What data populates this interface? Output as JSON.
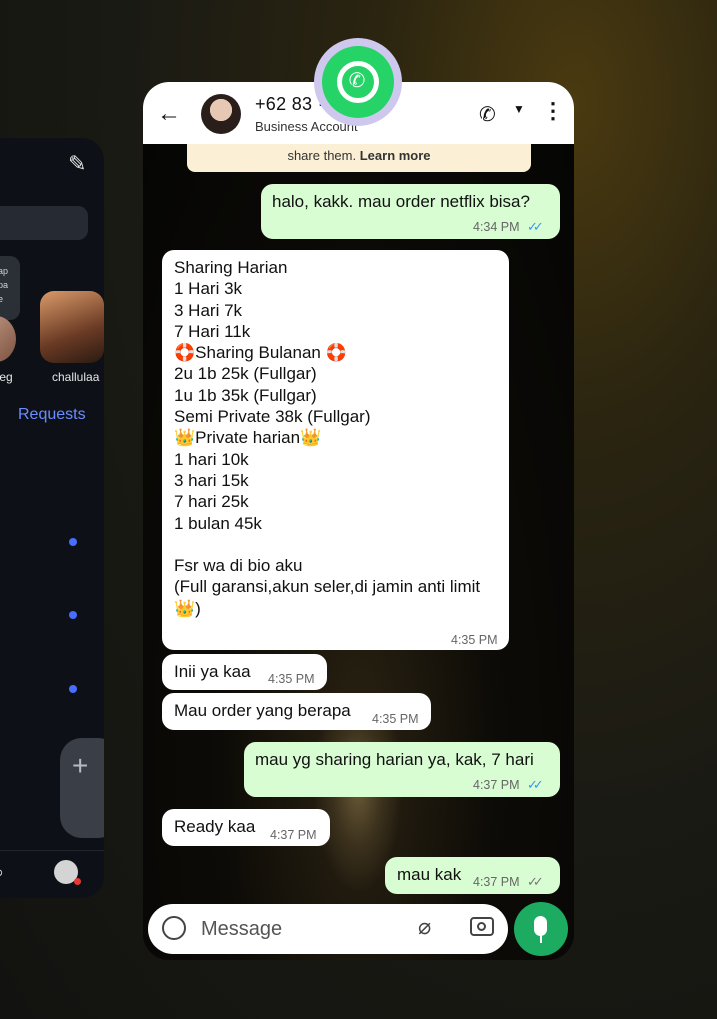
{
  "left_app": {
    "note_text": "ap\npa\ne",
    "story1_label": "jpeg",
    "story2_label": "challulaa",
    "requests_label": "Requests"
  },
  "header": {
    "contact_name": "+62 83 ·· ···· 44",
    "contact_subtitle": "Business Account"
  },
  "security_notice": {
    "text": "share them.",
    "link": "Learn more"
  },
  "messages": [
    {
      "dir": "out",
      "text": "halo, kakk. mau order netflix bisa?",
      "time": "4:34 PM",
      "status": "read"
    },
    {
      "dir": "in",
      "text": "Sharing Harian\n1 Hari 3k\n3 Hari 7k\n7 Hari 11k\n🛟Sharing Bulanan 🛟\n2u 1b 25k (Fullgar)\n1u 1b 35k (Fullgar)\nSemi Private 38k (Fullgar)\n👑Private harian👑\n1 hari 10k\n3 hari 15k\n7 hari 25k\n1 bulan 45k\n\nFsr wa di bio aku\n(Full garansi,akun seler,di jamin anti limit\n👑)",
      "time": "4:35 PM"
    },
    {
      "dir": "in",
      "text": "Inii ya kaa",
      "time": "4:35 PM"
    },
    {
      "dir": "in",
      "text": "Mau order yang berapa",
      "time": "4:35 PM"
    },
    {
      "dir": "out",
      "text": "mau yg sharing harian ya, kak, 7 hari",
      "time": "4:37 PM",
      "status": "read"
    },
    {
      "dir": "in",
      "text": "Ready kaa",
      "time": "4:37 PM"
    },
    {
      "dir": "out",
      "text": "mau kak",
      "time": "4:37 PM",
      "status": "delivered"
    }
  ],
  "composer": {
    "placeholder": "Message"
  },
  "icons": [
    "back-arrow-icon",
    "phone-icon",
    "more-vert-icon",
    "emoji-icon",
    "attach-icon",
    "camera-icon",
    "mic-icon",
    "whatsapp-icon",
    "compose-icon",
    "plus-icon"
  ],
  "colors": {
    "outgoing": "#d9fdd3",
    "incoming": "#ffffff",
    "accent": "#1daa61",
    "read_tick": "#3497f9"
  }
}
